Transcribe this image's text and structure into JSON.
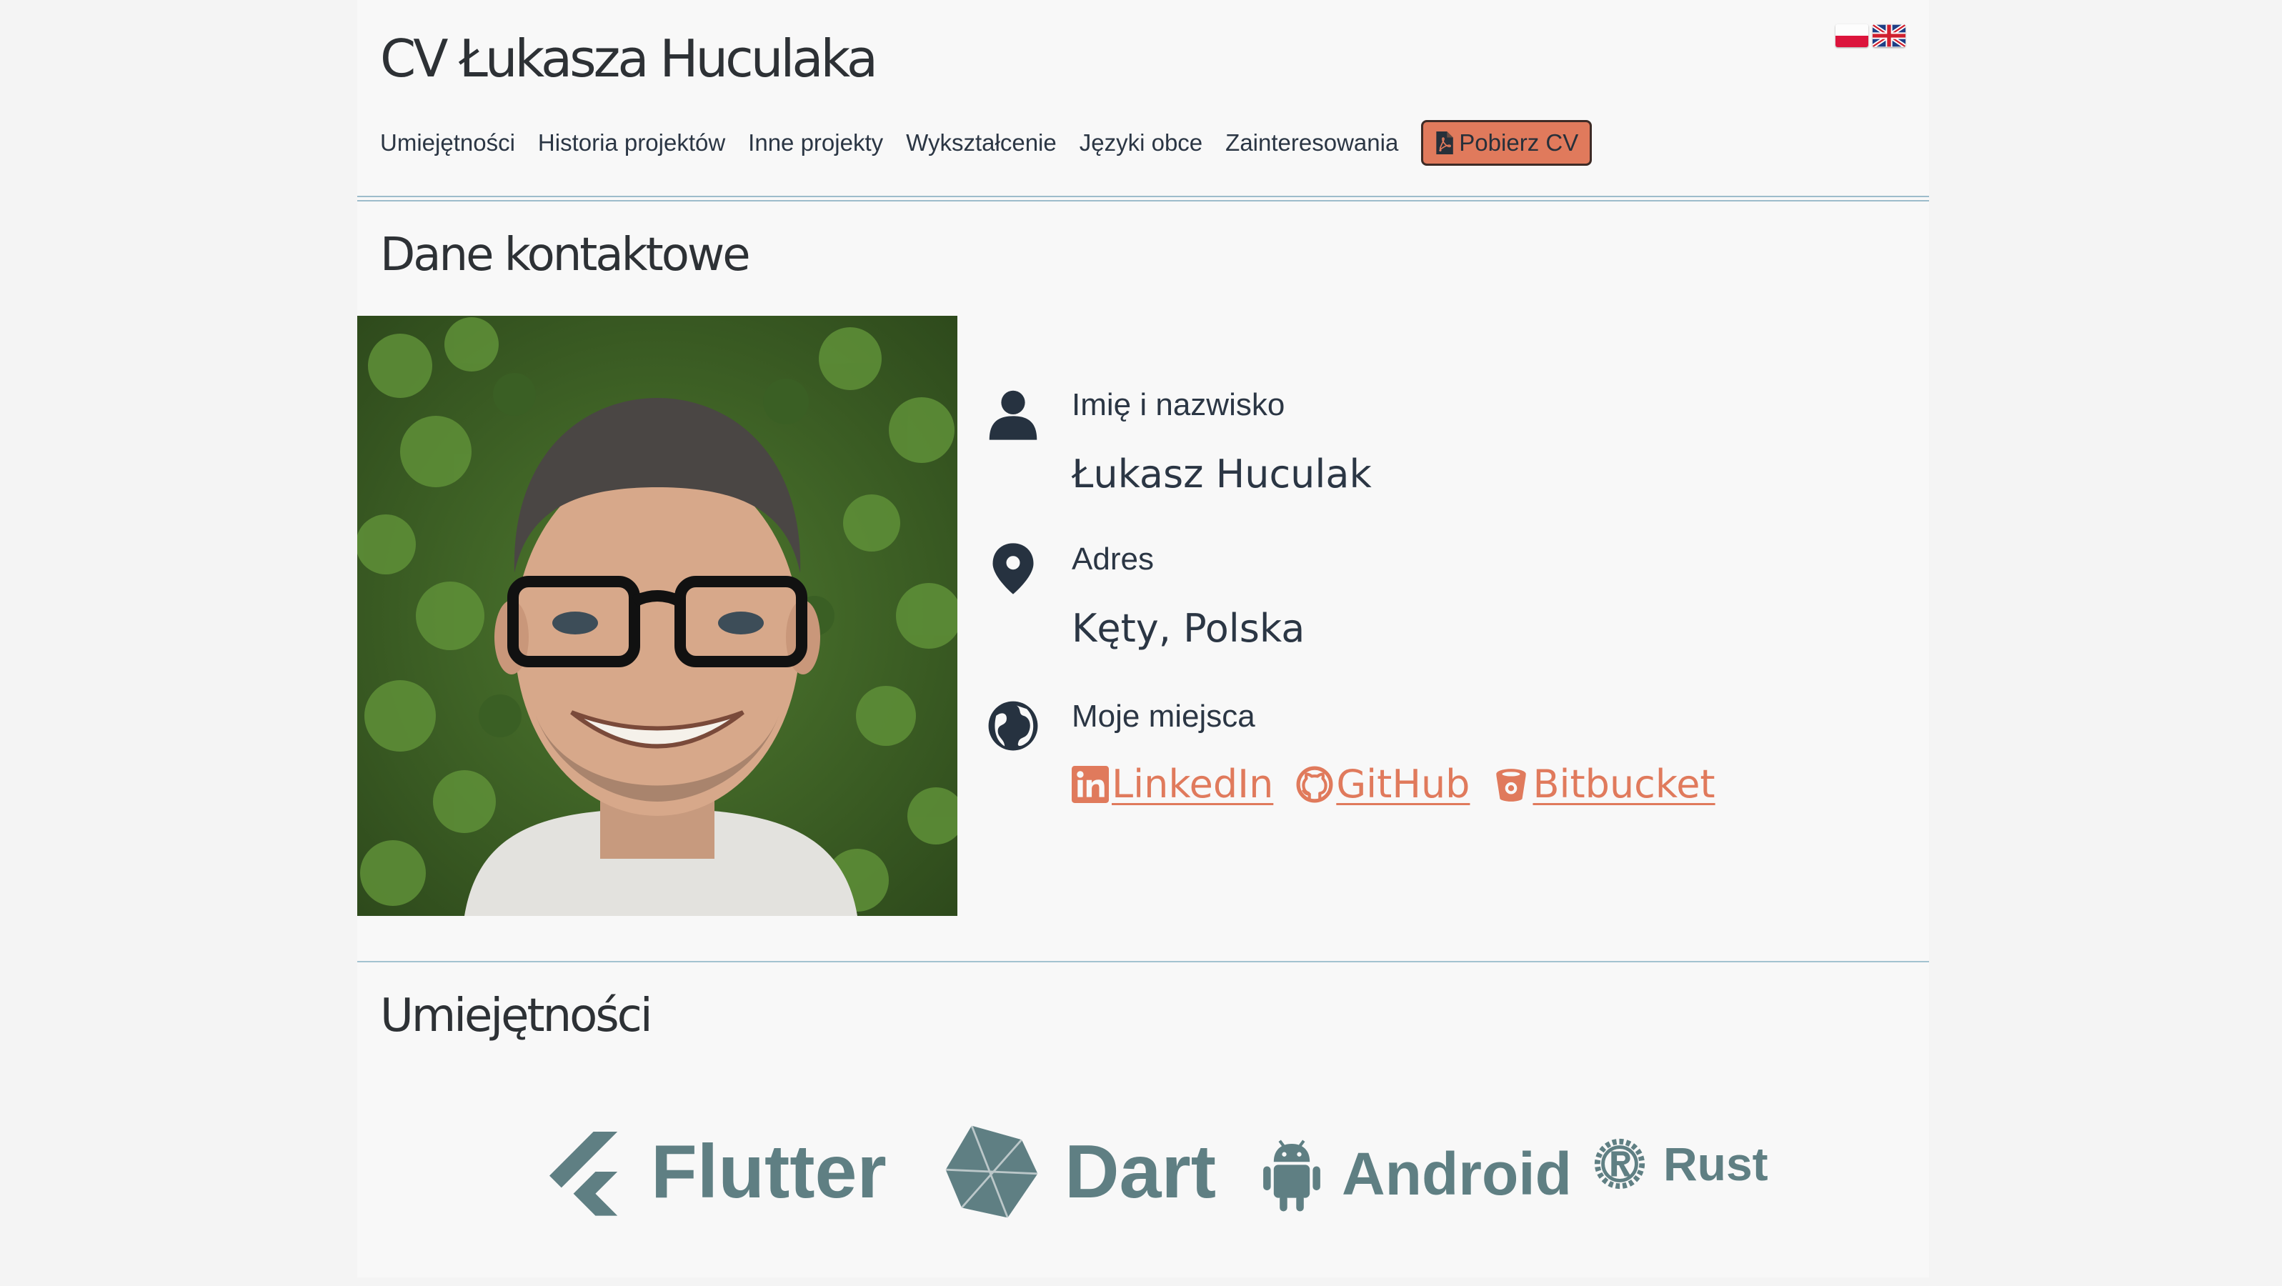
{
  "header": {
    "title": "CV Łukasza Huculaka",
    "flags": [
      "flag-pl-icon",
      "flag-uk-icon"
    ]
  },
  "nav": {
    "items": [
      "Umiejętności",
      "Historia projektów",
      "Inne projekty",
      "Wykształcenie",
      "Języki obce",
      "Zainteresowania"
    ],
    "download_label": "Pobierz CV"
  },
  "contact": {
    "heading": "Dane kontaktowe",
    "name_label": "Imię i nazwisko",
    "name_value": "Łukasz Huculak",
    "address_label": "Adres",
    "address_value": "Kęty, Polska",
    "places_label": "Moje miejsca",
    "links": [
      "LinkedIn",
      "GitHub",
      "Bitbucket"
    ]
  },
  "skills": {
    "heading": "Umiejętności",
    "row1": [
      "Flutter",
      "Dart",
      "Android",
      "Rust"
    ]
  },
  "colors": {
    "accent": "#e07a5c",
    "text": "#2b3644",
    "skill": "#5f7f83",
    "rule": "#9dbccb"
  }
}
